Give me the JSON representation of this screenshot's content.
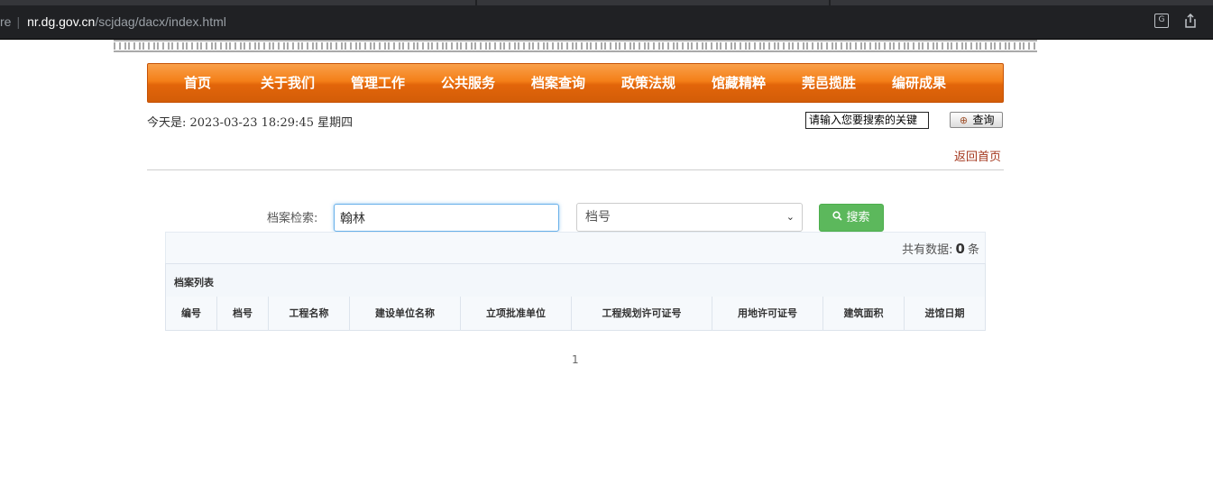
{
  "browser": {
    "url_prefix": "re",
    "url_host": "nr.dg.gov.cn",
    "url_path": "/scjdag/dacx/index.html"
  },
  "nav": {
    "items": [
      {
        "label": "首页"
      },
      {
        "label": "关于我们"
      },
      {
        "label": "管理工作"
      },
      {
        "label": "公共服务"
      },
      {
        "label": "档案查询"
      },
      {
        "label": "政策法规"
      },
      {
        "label": "馆藏精粹"
      },
      {
        "label": "莞邑揽胜"
      },
      {
        "label": "编研成果"
      }
    ]
  },
  "header": {
    "date_text": "今天是:  2023-03-23 18:29:45 星期四",
    "keyword_value": "请输入您要搜索的关键",
    "query_label": "查询",
    "back_home": "返回首页"
  },
  "search": {
    "label": "档案检索:",
    "input_value": "翰林",
    "select_value": "档号",
    "button_label": "搜索"
  },
  "results": {
    "count_prefix": "共有数据:",
    "count": "0",
    "count_suffix": "条",
    "list_title": "档案列表",
    "columns": [
      "编号",
      "档号",
      "工程名称",
      "建设单位名称",
      "立项批准单位",
      "工程规划许可证号",
      "用地许可证号",
      "建筑面积",
      "进馆日期"
    ],
    "page": "1"
  },
  "colors": {
    "nav_orange": "#f47f18",
    "search_green": "#5cb85c",
    "link_red": "#a4371d"
  }
}
